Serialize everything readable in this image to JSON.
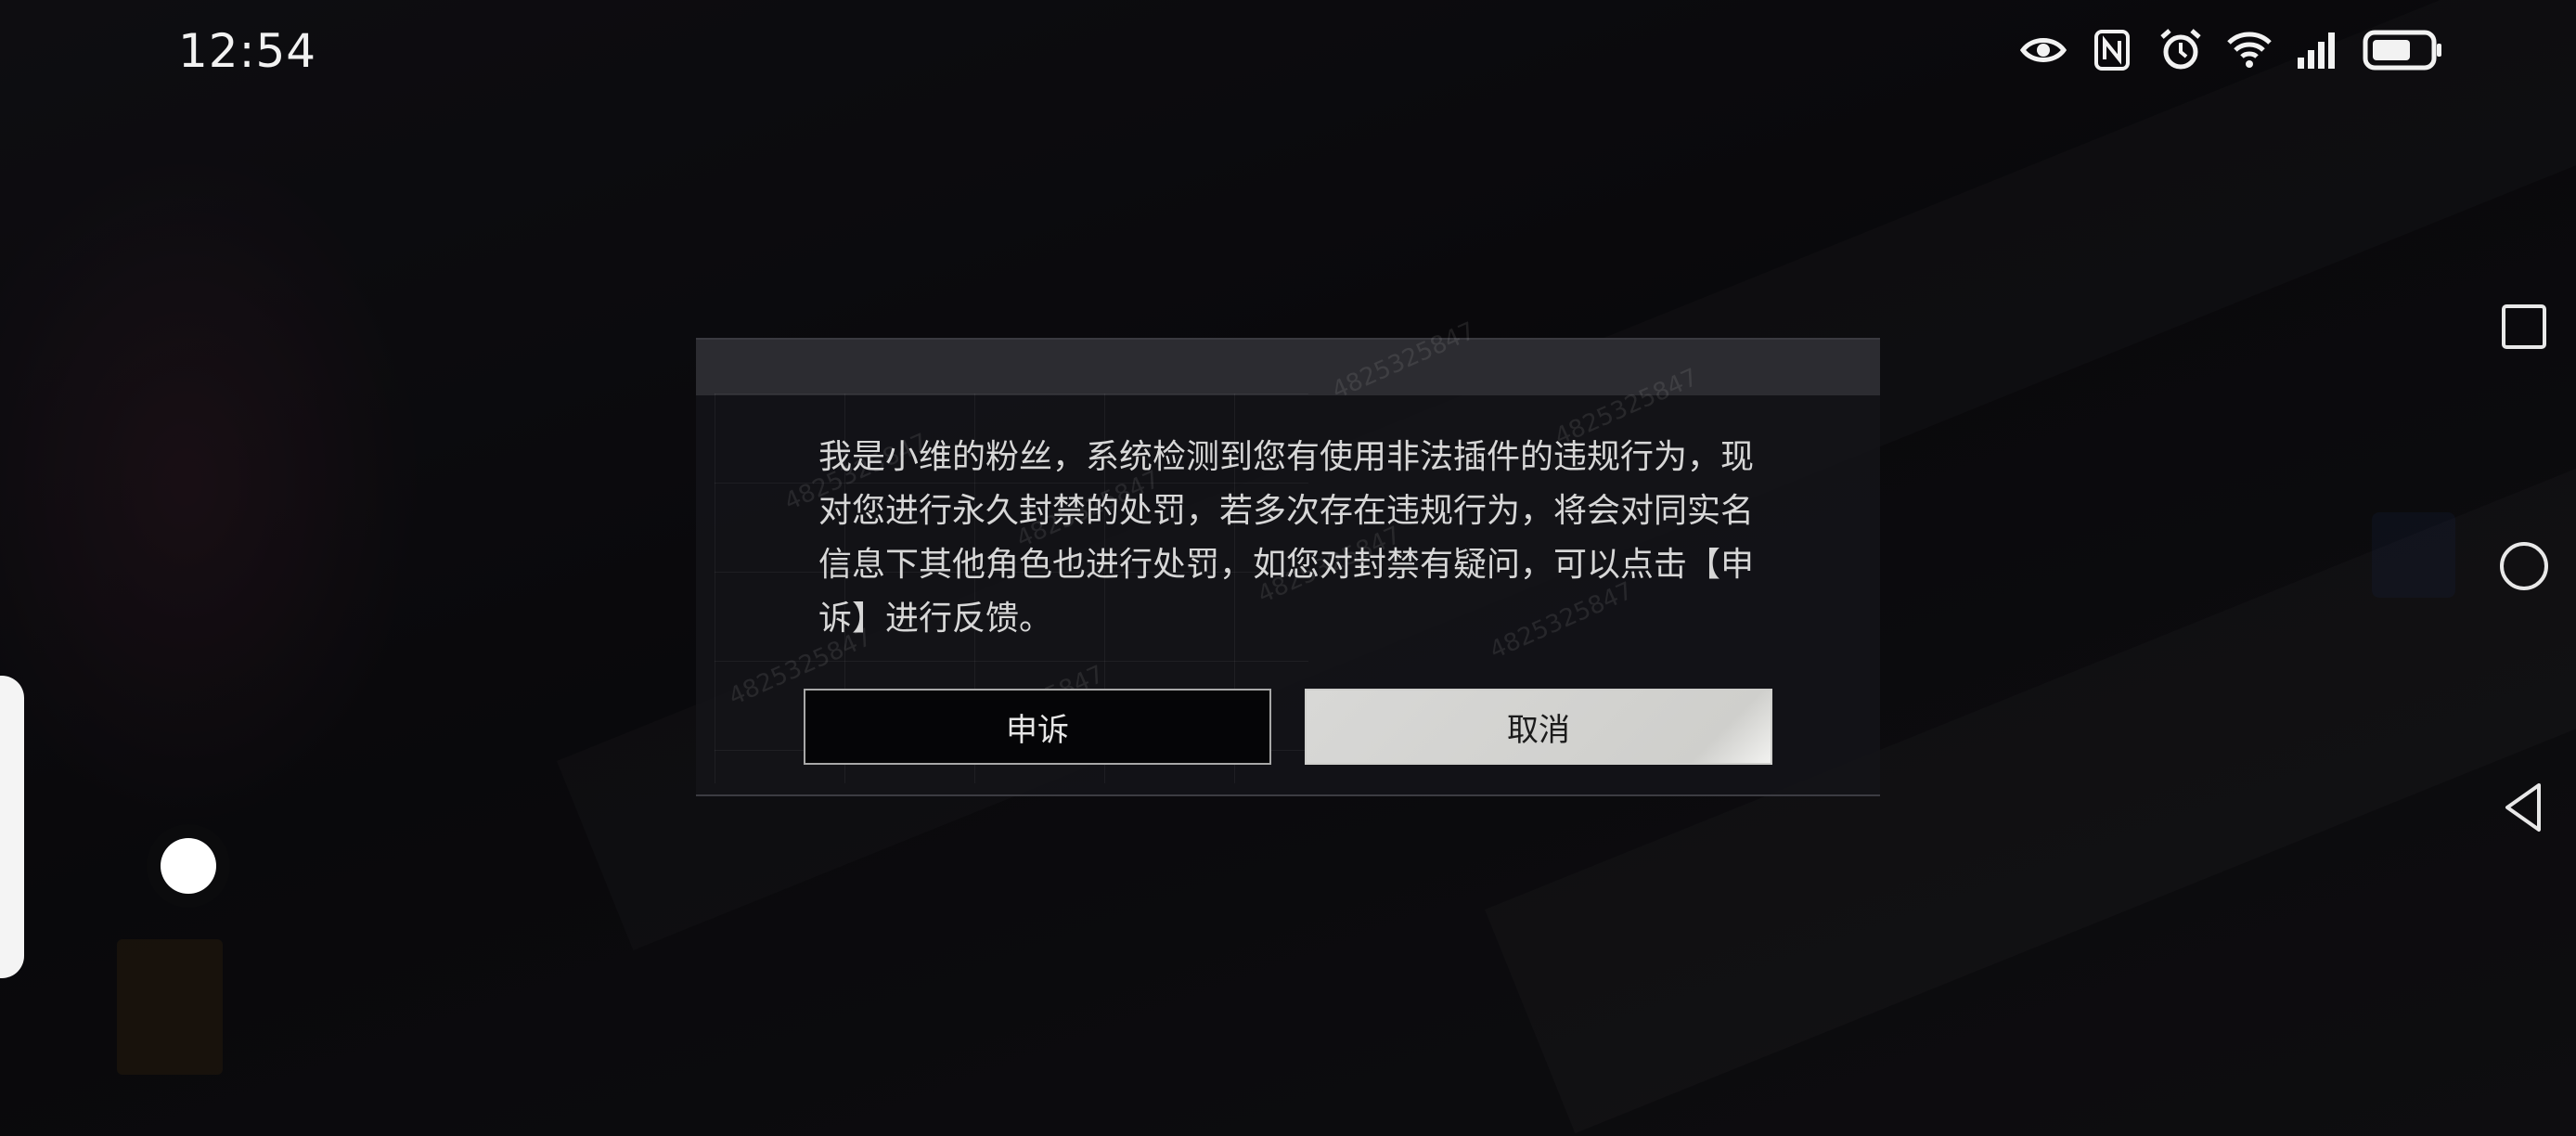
{
  "status_bar": {
    "time": "12:54",
    "icons": [
      "eye-icon",
      "nfc-icon",
      "alarm-icon",
      "wifi-icon",
      "signal-icon",
      "battery-icon"
    ]
  },
  "nav_bar": {
    "items": [
      "recent-apps-square-icon",
      "home-circle-icon",
      "back-triangle-icon"
    ]
  },
  "dialog": {
    "message": "我是小维的粉丝，系统检测到您有使用非法插件的违规行为，现对您进行永久封禁的处罚，若多次存在违规行为，将会对同实名信息下其他角色也进行处罚，如您对封禁有疑问，可以点击【申诉】进行反馈。",
    "appeal_label": "申诉",
    "cancel_label": "取消",
    "watermark": "4825325847"
  },
  "colors": {
    "dialog_bg": "#141318",
    "dialog_header": "#2c2c31",
    "cancel_button": "#d8d8d6",
    "appeal_button": "#050507"
  }
}
